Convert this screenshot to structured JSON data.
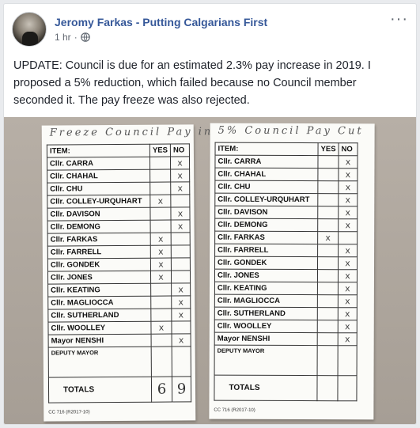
{
  "post": {
    "author": "Jeromy Farkas - Putting Calgarians First",
    "time": "1 hr",
    "separator": "·",
    "more": "···",
    "text": "UPDATE: Council is due for an estimated 2.3% pay increase in 2019. I proposed a 5% reduction, which failed because no Council member seconded it. The pay freeze was also rejected.",
    "icons": {
      "privacy": "globe-icon",
      "menu": "more-options-icon"
    }
  },
  "sheets": [
    {
      "title": "Freeze Council Pay in 2019",
      "header": {
        "item": "ITEM:",
        "yes": "YES",
        "no": "NO"
      },
      "rows": [
        {
          "name": "Cllr. CARRA",
          "yes": "",
          "no": "x"
        },
        {
          "name": "Cllr. CHAHAL",
          "yes": "",
          "no": "x"
        },
        {
          "name": "Cllr. CHU",
          "yes": "",
          "no": "x"
        },
        {
          "name": "Cllr. COLLEY-URQUHART",
          "yes": "x",
          "no": ""
        },
        {
          "name": "Cllr. DAVISON",
          "yes": "",
          "no": "x"
        },
        {
          "name": "Cllr. DEMONG",
          "yes": "",
          "no": "x"
        },
        {
          "name": "Cllr. FARKAS",
          "yes": "x",
          "no": ""
        },
        {
          "name": "Cllr. FARRELL",
          "yes": "x",
          "no": ""
        },
        {
          "name": "Cllr. GONDEK",
          "yes": "x",
          "no": ""
        },
        {
          "name": "Cllr. JONES",
          "yes": "x",
          "no": ""
        },
        {
          "name": "Cllr. KEATING",
          "yes": "",
          "no": "x"
        },
        {
          "name": "Cllr. MAGLIOCCA",
          "yes": "",
          "no": "x"
        },
        {
          "name": "Cllr. SUTHERLAND",
          "yes": "",
          "no": "x"
        },
        {
          "name": "Cllr. WOOLLEY",
          "yes": "x",
          "no": ""
        },
        {
          "name": "Mayor NENSHI",
          "yes": "",
          "no": "x"
        }
      ],
      "deputy": "DEPUTY MAYOR",
      "totals_label": "TOTALS",
      "total_yes": "6",
      "total_no": "9",
      "form_code": "CC 716 (R2017-10)"
    },
    {
      "title": "5% Council Pay Cut",
      "header": {
        "item": "ITEM:",
        "yes": "YES",
        "no": "NO"
      },
      "rows": [
        {
          "name": "Cllr. CARRA",
          "yes": "",
          "no": "x"
        },
        {
          "name": "Cllr. CHAHAL",
          "yes": "",
          "no": "x"
        },
        {
          "name": "Cllr. CHU",
          "yes": "",
          "no": "x"
        },
        {
          "name": "Cllr. COLLEY-URQUHART",
          "yes": "",
          "no": "x"
        },
        {
          "name": "Cllr. DAVISON",
          "yes": "",
          "no": "x"
        },
        {
          "name": "Cllr. DEMONG",
          "yes": "",
          "no": "x"
        },
        {
          "name": "Cllr. FARKAS",
          "yes": "x",
          "no": ""
        },
        {
          "name": "Cllr. FARRELL",
          "yes": "",
          "no": "x"
        },
        {
          "name": "Cllr. GONDEK",
          "yes": "",
          "no": "x"
        },
        {
          "name": "Cllr. JONES",
          "yes": "",
          "no": "x"
        },
        {
          "name": "Cllr. KEATING",
          "yes": "",
          "no": "x"
        },
        {
          "name": "Cllr. MAGLIOCCA",
          "yes": "",
          "no": "x"
        },
        {
          "name": "Cllr. SUTHERLAND",
          "yes": "",
          "no": "x"
        },
        {
          "name": "Cllr. WOOLLEY",
          "yes": "",
          "no": "x"
        },
        {
          "name": "Mayor NENSHI",
          "yes": "",
          "no": "x"
        }
      ],
      "deputy": "DEPUTY MAYOR",
      "totals_label": "TOTALS",
      "total_yes": "",
      "total_no": "",
      "form_code": "CC 716 (R2017-10)"
    }
  ]
}
